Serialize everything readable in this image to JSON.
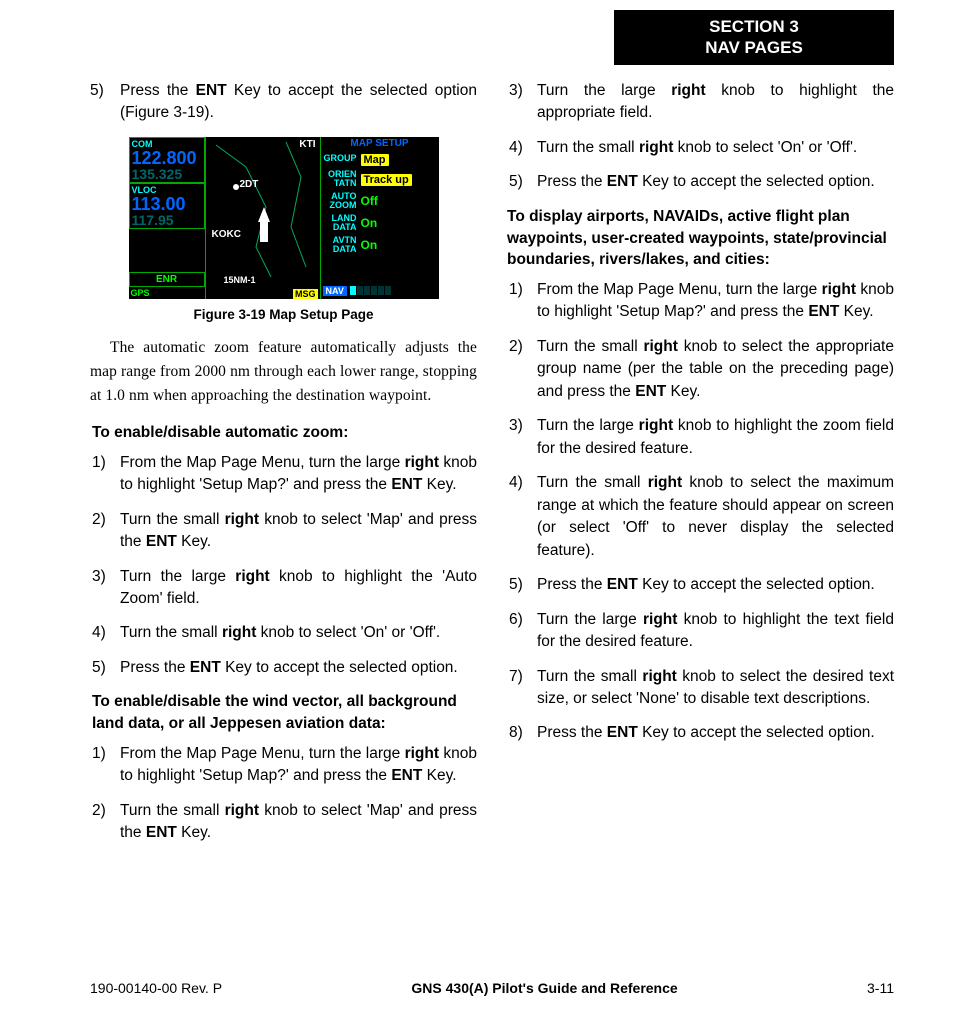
{
  "section_header": {
    "line1": "SECTION 3",
    "line2": "NAV PAGES"
  },
  "left": {
    "continued_step": {
      "num": "5)",
      "parts": [
        "Press the ",
        "ENT",
        " Key to accept the selected option (Figure 3-19)."
      ]
    },
    "figure_caption": "Figure 3-19  Map Setup Page",
    "device": {
      "com_label": "COM",
      "com_active": "122.800",
      "com_standby": "135.325",
      "vloc_label": "VLOC",
      "vloc_active": "113.00",
      "vloc_standby": "117.95",
      "enr": "ENR",
      "gps": "GPS",
      "map_kti": "KTI",
      "map_2dt": "2DT",
      "map_kokc": "KOKC",
      "map_scale": "15NM-1",
      "msg": "MSG",
      "title": "MAP SETUP",
      "rows": [
        {
          "key": "GROUP",
          "val": "Map",
          "style": "pill"
        },
        {
          "key": "ORIEN\nTATN",
          "val": "Track up",
          "style": "pill"
        },
        {
          "key": "AUTO\nZOOM",
          "val": "Off",
          "style": "green"
        },
        {
          "key": "LAND\nDATA",
          "val": "On",
          "style": "green"
        },
        {
          "key": "AVTN\nDATA",
          "val": "On",
          "style": "green"
        }
      ],
      "nav": "NAV"
    },
    "body_paragraph": "The automatic zoom feature automatically adjusts the map range from 2000 nm through each lower range, stopping at 1.0 nm when approaching the destination waypoint.",
    "heading1": "To enable/disable automatic zoom:",
    "steps1": [
      {
        "num": "1)",
        "parts": [
          "From the Map Page Menu, turn the large ",
          "right",
          " knob to highlight 'Setup Map?' and press the ",
          "ENT",
          " Key."
        ]
      },
      {
        "num": "2)",
        "parts": [
          "Turn the small ",
          "right",
          " knob to select 'Map' and press the ",
          "ENT",
          " Key."
        ]
      },
      {
        "num": "3)",
        "parts": [
          "Turn the large ",
          "right",
          " knob to highlight the 'Auto Zoom' field."
        ]
      },
      {
        "num": "4)",
        "parts": [
          "Turn the small ",
          "right",
          " knob to select 'On' or 'Off'."
        ]
      },
      {
        "num": "5)",
        "parts": [
          "Press the ",
          "ENT",
          " Key to accept the selected option."
        ]
      }
    ],
    "heading2": "To enable/disable the wind vector, all background land data, or all Jeppesen aviation data:",
    "steps2": [
      {
        "num": "1)",
        "parts": [
          "From the Map Page Menu, turn the large ",
          "right",
          " knob to highlight 'Setup Map?' and press the ",
          "ENT",
          " Key."
        ]
      },
      {
        "num": "2)",
        "parts": [
          "Turn the small ",
          "right",
          " knob to select 'Map' and press the ",
          "ENT",
          " Key."
        ]
      }
    ]
  },
  "right": {
    "steps_cont": [
      {
        "num": "3)",
        "parts": [
          "Turn the large ",
          "right",
          " knob to highlight the appropriate field."
        ]
      },
      {
        "num": "4)",
        "parts": [
          "Turn the small ",
          "right",
          " knob to select 'On' or 'Off'."
        ]
      },
      {
        "num": "5)",
        "parts": [
          "Press the ",
          "ENT",
          " Key to accept the selected option."
        ]
      }
    ],
    "heading3": "To display airports, NAVAIDs, active flight plan waypoints, user-created waypoints, state/provincial boundaries, rivers/lakes, and cities:",
    "steps3": [
      {
        "num": "1)",
        "parts": [
          "From the Map Page Menu, turn the large ",
          "right",
          " knob to highlight 'Setup Map?' and press the ",
          "ENT",
          " Key."
        ]
      },
      {
        "num": "2)",
        "parts": [
          "Turn the small ",
          "right",
          " knob to select the appropriate group name (per the table on the preceding page) and press the ",
          "ENT",
          " Key."
        ]
      },
      {
        "num": "3)",
        "parts": [
          "Turn the large ",
          "right",
          " knob to highlight the zoom field for the desired feature."
        ]
      },
      {
        "num": "4)",
        "parts": [
          "Turn the small ",
          "right",
          " knob to select the maximum range at which the feature should appear on screen (or select 'Off' to never display the selected feature)."
        ]
      },
      {
        "num": "5)",
        "parts": [
          "Press the ",
          "ENT",
          " Key to accept the selected option."
        ]
      },
      {
        "num": "6)",
        "parts": [
          "Turn the large ",
          "right",
          " knob to highlight the text field for the desired feature."
        ]
      },
      {
        "num": "7)",
        "parts": [
          "Turn the small ",
          "right",
          " knob to select the desired text size, or select 'None' to disable text descriptions."
        ]
      },
      {
        "num": "8)",
        "parts": [
          "Press the ",
          "ENT",
          " Key to accept the selected option."
        ]
      }
    ]
  },
  "footer": {
    "left": "190-00140-00  Rev. P",
    "mid": "GNS 430(A) Pilot's Guide and Reference",
    "right": "3-11"
  }
}
